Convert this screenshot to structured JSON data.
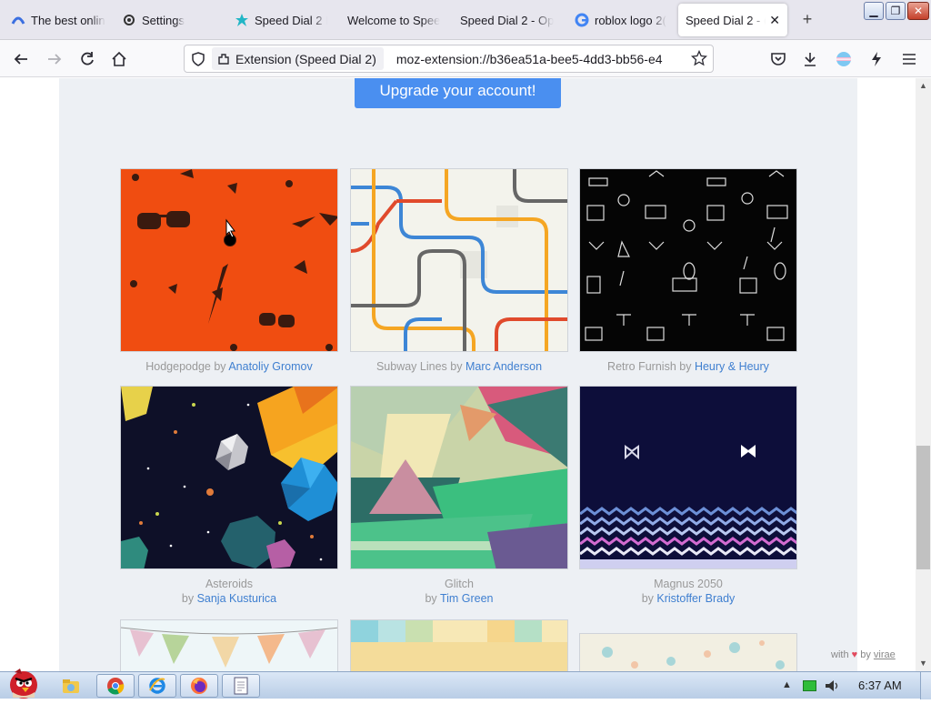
{
  "browser": {
    "tabs": [
      {
        "label": "The best onlin",
        "icon": "mullvad-icon",
        "active": false
      },
      {
        "label": "Settings",
        "icon": "gear-icon",
        "active": false
      },
      {
        "label": "Speed Dial 2 I",
        "icon": "speed-dial-icon",
        "active": false
      },
      {
        "label": "Welcome to Spee",
        "icon": "",
        "active": false
      },
      {
        "label": "Speed Dial 2 - Op",
        "icon": "",
        "active": false
      },
      {
        "label": "roblox logo 2(",
        "icon": "google-icon",
        "active": false
      },
      {
        "label": "Speed Dial 2 - (",
        "icon": "",
        "active": true
      }
    ],
    "new_tab": "+",
    "url_identity": "Extension (Speed Dial 2)",
    "url": "moz-extension://b36ea51a-bee5-4dd3-bb56-e4"
  },
  "page": {
    "upgrade_button": "Upgrade your account!",
    "wallpapers": [
      {
        "title": "Hodgepodge",
        "by": "by",
        "author": "Anatoliy Gromov",
        "thumb": "hodgepodge"
      },
      {
        "title": "Subway Lines",
        "by": "by",
        "author": "Marc Anderson",
        "thumb": "subway"
      },
      {
        "title": "Retro Furnish",
        "by": "by",
        "author": "Heury & Heury",
        "thumb": "retro"
      },
      {
        "title": "Asteroids",
        "by": "by",
        "author": "Sanja Kusturica",
        "thumb": "asteroids"
      },
      {
        "title": "Glitch",
        "by": "by",
        "author": "Tim Green",
        "thumb": "glitch"
      },
      {
        "title": "Magnus 2050",
        "by": "by",
        "author": "Kristoffer Brady",
        "thumb": "magnus"
      }
    ],
    "credit_with": "with",
    "credit_by": "by",
    "credit_author": "virae"
  },
  "taskbar": {
    "clock": "6:37 AM",
    "apps": [
      "angry-birds-icon",
      "explorer-icon",
      "chrome-icon",
      "ie-icon",
      "firefox-icon",
      "notepad-icon"
    ]
  },
  "colors": {
    "accent": "#4a8ff0",
    "link": "#3f7fd0",
    "panel": "#edf0f4"
  }
}
